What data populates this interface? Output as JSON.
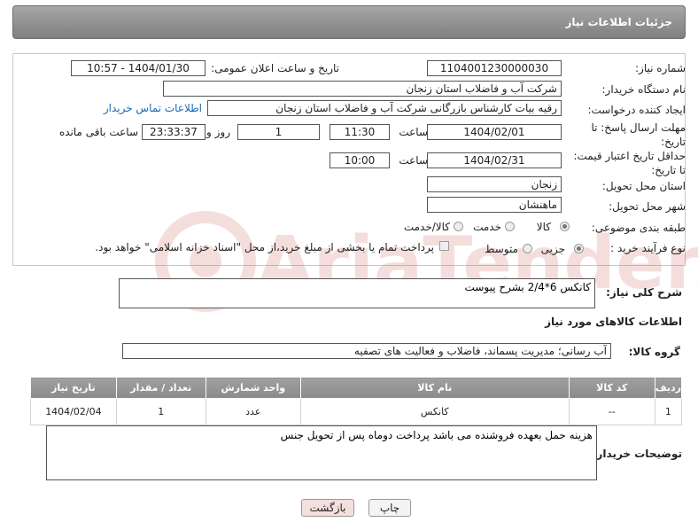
{
  "header": {
    "title": "جزئیات اطلاعات نیاز"
  },
  "form": {
    "need_number_label": "شماره نیاز:",
    "need_number": "1104001230000030",
    "announce_label": "تاریخ و ساعت اعلان عمومی:",
    "announce_value": "1404/01/30 - 10:57",
    "buyer_org_label": "نام دستگاه خریدار:",
    "buyer_org": "شرکت آب و فاضلاب استان زنجان",
    "creator_label": "ایجاد کننده درخواست:",
    "creator": "رقیه بیات کارشناس بازرگانی شرکت آب و فاضلاب استان زنجان",
    "contact_link": "اطلاعات تماس خریدار",
    "deadline_label": "مهلت ارسال پاسخ: تا تاریخ:",
    "deadline_date": "1404/02/01",
    "time_label": "ساعت",
    "deadline_time": "11:30",
    "days_value": "1",
    "days_label": "روز و",
    "remaining_value": "23:33:37",
    "remaining_label": "ساعت باقی مانده",
    "price_validity_label": "حداقل تاریخ اعتبار قیمت: تا تاریخ:",
    "price_validity_date": "1404/02/31",
    "price_validity_time": "10:00",
    "province_label": "استان محل تحویل:",
    "province": "زنجان",
    "city_label": "شهر محل تحویل:",
    "city": "ماهنشان",
    "category_label": "طبقه بندی موضوعی:",
    "category_options": [
      "کالا",
      "خدمت",
      "کالا/خدمت"
    ],
    "category_selected": "کالا",
    "process_label": "نوع فرآیند خرید :",
    "process_options": [
      "جزیی",
      "متوسط"
    ],
    "process_selected": "جزیی",
    "payment_note": "پرداخت تمام یا بخشی از مبلغ خرید،از محل \"اسناد خزانه اسلامی\" خواهد بود."
  },
  "summary": {
    "label": "شرح کلی نیاز:",
    "value": "کانکس 6*2/4 بشرح پیوست"
  },
  "goods": {
    "section_title": "اطلاعات کالاهای مورد نیاز",
    "group_label": "گروه کالا:",
    "group_value": "آب رسانی؛ مدیریت پسماند، فاضلاب و فعالیت های تصفیه",
    "columns": [
      "ردیف",
      "کد کالا",
      "نام کالا",
      "واحد شمارش",
      "تعداد / مقدار",
      "تاریخ نیاز"
    ],
    "rows": [
      {
        "row": "1",
        "code": "--",
        "name": "کانکس",
        "unit": "عدد",
        "qty": "1",
        "date": "1404/02/04"
      }
    ]
  },
  "buyer_notes": {
    "label": "توضیحات خریدار:",
    "value": "هزینه حمل بعهده فروشنده می باشد پرداخت دوماه پس از تحویل جنس"
  },
  "buttons": {
    "print": "چاپ",
    "back": "بازگشت"
  },
  "watermark": {
    "text": "AriaTender.neT"
  },
  "colors": {
    "header_bg": "#8c8c8c",
    "link": "#1a6ab0",
    "back_button_bg": "#f5dede"
  }
}
